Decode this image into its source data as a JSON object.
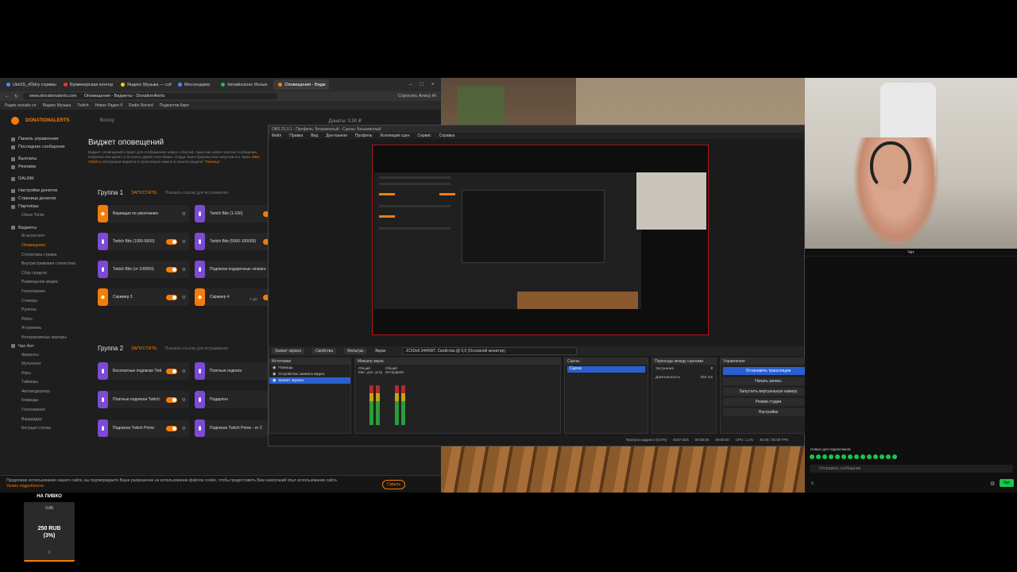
{
  "browser": {
    "tabs": [
      {
        "label": "Ulet15_#Ödгу стримы",
        "color": "#4a8cff"
      },
      {
        "label": "Букмекерская контор",
        "color": "#e33"
      },
      {
        "label": "Яндекс Музыка — соб",
        "color": "#fc0"
      },
      {
        "label": "Мессенджер",
        "color": "#4a8cff"
      },
      {
        "label": "Китайнсконс Яснын",
        "color": "#19c54b"
      },
      {
        "label": "Оповещения - Видж",
        "color": "#f57d07"
      }
    ],
    "url": "www.donationalerts.com",
    "page_title": "Оповещения - Виджеты - DonationAlerts",
    "alice": "Спросить Алису AI",
    "bookmarks": [
      "Радио онлайн сл",
      "Яндекс Музыка",
      "Twitch",
      "Новое Радио б",
      "Radio Record",
      "Подкастов Кирп"
    ]
  },
  "da": {
    "logo": "DONATIONALERTS",
    "boosty": "Boosty",
    "balance": "Донаты: 0,00 ₽",
    "user": "v0rOhobbit"
  },
  "sidebar": {
    "items": [
      {
        "label": "Панель управления",
        "type": "item"
      },
      {
        "label": "Последние сообщения",
        "type": "item"
      },
      {
        "type": "gap"
      },
      {
        "label": "Выплаты",
        "type": "item"
      },
      {
        "label": "Реклама",
        "type": "item"
      },
      {
        "type": "gap"
      },
      {
        "label": "DALINK",
        "type": "item"
      },
      {
        "type": "gap"
      },
      {
        "label": "Настройки донатов",
        "type": "item"
      },
      {
        "label": "Страница донатов",
        "type": "item"
      },
      {
        "label": "Партнёры",
        "type": "item"
      },
      {
        "label": "Chess Tricks",
        "type": "sub"
      },
      {
        "type": "gap"
      },
      {
        "label": "Виджеты",
        "type": "item"
      },
      {
        "label": "AI-ассистент",
        "type": "sub"
      },
      {
        "label": "Оповещения",
        "type": "sub",
        "active": true
      },
      {
        "label": "Статистика стрима",
        "type": "sub"
      },
      {
        "label": "Внутристримовая статистика",
        "type": "sub"
      },
      {
        "label": "Сбор средств",
        "type": "sub"
      },
      {
        "label": "Размещение медиа",
        "type": "sub"
      },
      {
        "label": "Голосования",
        "type": "sub"
      },
      {
        "label": "Стикеры",
        "type": "sub"
      },
      {
        "label": "Рулетка",
        "type": "sub"
      },
      {
        "label": "Plinko",
        "type": "sub"
      },
      {
        "label": "AI-уровень",
        "type": "sub"
      },
      {
        "label": "Интерактивные аватары",
        "type": "sub"
      },
      {
        "label": "Чат-бот",
        "type": "item"
      },
      {
        "label": "Аккаунты",
        "type": "sub"
      },
      {
        "label": "Мультичат",
        "type": "sub"
      },
      {
        "label": "Игры",
        "type": "sub"
      },
      {
        "label": "Таймеры",
        "type": "sub"
      },
      {
        "label": "Автомодератор",
        "type": "sub"
      },
      {
        "label": "Команды",
        "type": "sub"
      },
      {
        "label": "Голосования",
        "type": "sub"
      },
      {
        "label": "Вардиддер",
        "type": "sub"
      },
      {
        "label": "Бегущая строка",
        "type": "sub"
      }
    ]
  },
  "main": {
    "title": "Виджет оповещений",
    "desc_1": "Виджет оповещений служит для отображения новых событий, таких как новое платное сообщение, подписка или донат, и",
    "desc_2": "встроить двумя способами: откуда через браузер или запустив его через",
    "desc_hl": "OBS, XSplit и",
    "desc_3": "интеграции виджета в трансляцию можно в нашем разделе",
    "desc_link": "\"Помощь\"",
    "group1": {
      "title": "Группа 1",
      "launch": "ЗАПУСТИТЬ",
      "link": "Показать ссылку для встраивания"
    },
    "group2": {
      "title": "Группа 2",
      "launch": "ЗАПУСТИТЬ",
      "link": "Показать ссылку для встраивания"
    },
    "add": "+ до",
    "cards1": [
      {
        "name": "Вариация по умолчанию",
        "badge": "orange",
        "toggle": false
      },
      {
        "name": "Twitch Bits (1-100)",
        "badge": "purple",
        "toggle": true
      },
      {
        "name": "Twitch Bits (1000-5000)",
        "badge": "purple",
        "toggle": true
      },
      {
        "name": "Twitch Bits (5000-100000)",
        "badge": "purple",
        "toggle": true
      },
      {
        "name": "Twitch Bits (от 100000)",
        "badge": "purple",
        "toggle": true
      },
      {
        "name": "Подписки подарочные sinstaro",
        "badge": "purple",
        "toggle": false
      },
      {
        "name": "Скример 3",
        "badge": "orange",
        "toggle": true
      },
      {
        "name": "Скример 4",
        "badge": "orange",
        "toggle": true
      }
    ],
    "cards2": [
      {
        "name": "Бесплатные подписки Twitch",
        "badge": "purple",
        "toggle": true
      },
      {
        "name": "Платные подписк",
        "badge": "purple",
        "toggle": false
      },
      {
        "name": "Платные подписки Twitch - от 2 месяцев",
        "badge": "purple",
        "toggle": true
      },
      {
        "name": "Подарочн",
        "badge": "purple",
        "toggle": false
      },
      {
        "name": "Подписки Twitch Prime",
        "badge": "purple",
        "toggle": true
      },
      {
        "name": "Подписки Twitch Prime - от 2",
        "badge": "purple",
        "toggle": false
      }
    ]
  },
  "cookie": {
    "text": "Продолжая использование нашего сайта, вы подтверждаете Ваше разрешение на использование файлов cookie, чтобы предоставить Вам наилучший опыт использования сайта.",
    "link": "Узнать подробности",
    "button": "Скрыть"
  },
  "obs": {
    "title": "OBS 31.0.1 - Профиль: Безымянный - Сцены: Безымянный",
    "menu": [
      "Файл",
      "Правка",
      "Вид",
      "Док-панели",
      "Профиль",
      "Коллекция сцен",
      "Сервис",
      "Справка"
    ],
    "bar_source": "Захват экрана",
    "bar_props": "Свойства",
    "bar_filters": "Фильтры",
    "bar_screen_label": "Экран",
    "bar_device": "JCI\\Dell 3440WT. Свойства @ 0,0 (Основной монитор)",
    "sources_title": "Источники",
    "sources": [
      {
        "label": "Помощь",
        "selected": false
      },
      {
        "label": "Устройство захвата видео",
        "selected": false
      },
      {
        "label": "Захват экрана",
        "selected": true
      }
    ],
    "mixer_title": "Микшер звука",
    "mixer_ch1": "Общий",
    "mixer_ch2": "Общий",
    "mixer_ch1_sub": "Мис. доп. устр",
    "mixer_ch2_sub": "Интерфейс",
    "scenes_title": "Сцены",
    "scene_selected": "Сцена",
    "transitions_title": "Переходы между сценами",
    "transition": "Затухание",
    "duration_label": "Длительность",
    "duration": "300 ms",
    "controls_title": "Управление",
    "controls": [
      {
        "label": "Остановить трансляцию",
        "primary": true
      },
      {
        "label": "Начать запись",
        "primary": false
      },
      {
        "label": "Запустить виртуальную камеру",
        "primary": false
      },
      {
        "label": "Режим студии",
        "primary": false
      },
      {
        "label": "Настройки",
        "primary": false
      }
    ],
    "status": [
      "Пропуск кадров 0 (0.0%)",
      "8167 kb/s",
      "00:08:56",
      "00:00:00",
      "CPU: 1.1%",
      "30.00 / 30.00 FPS"
    ],
    "bottom_label": "Сцены"
  },
  "chat": {
    "header": "Чат",
    "subs_label": "Новые для подписчиков",
    "placeholder": "Отправить сообщение",
    "viewers": "0",
    "send": "Чат"
  },
  "goal": {
    "title": "НА ПИВКО",
    "current": "0,88",
    "amount": "250 RUB",
    "percent": "(3%)",
    "start": "0"
  }
}
